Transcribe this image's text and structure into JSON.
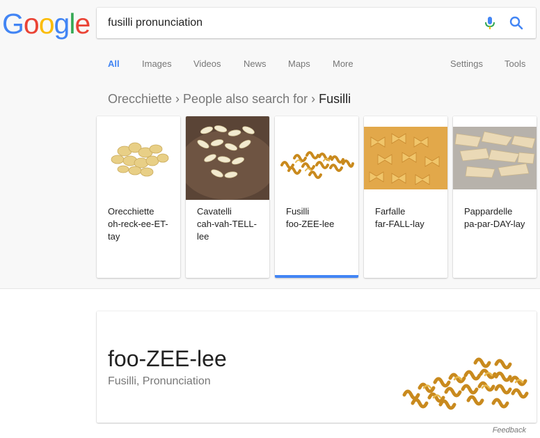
{
  "logo": {
    "letters": [
      "G",
      "o",
      "o",
      "g",
      "l",
      "e"
    ],
    "colors": [
      "#4285f4",
      "#ea4335",
      "#fbbc05",
      "#4285f4",
      "#34a853",
      "#ea4335"
    ]
  },
  "search": {
    "query": "fusilli pronunciation"
  },
  "tabs": {
    "all": "All",
    "images": "Images",
    "videos": "Videos",
    "news": "News",
    "maps": "Maps",
    "more": "More",
    "settings": "Settings",
    "tools": "Tools"
  },
  "breadcrumb": {
    "first": "Orecchiette",
    "second": "People also search for",
    "current": "Fusilli"
  },
  "carousel": [
    {
      "name": "Orecchiette",
      "pron": "oh-reck-ee-ET-tay",
      "icon": "orecchiette-image"
    },
    {
      "name": "Cavatelli",
      "pron": "cah-vah-TELL-lee",
      "icon": "cavatelli-image"
    },
    {
      "name": "Fusilli",
      "pron": "foo-ZEE-lee",
      "icon": "fusilli-image",
      "selected": true
    },
    {
      "name": "Farfalle",
      "pron": "far-FALL-lay",
      "icon": "farfalle-image"
    },
    {
      "name": "Pappardelle",
      "pron": "pa-par-DAY-lay",
      "icon": "pappardelle-image"
    }
  ],
  "answer": {
    "pronunciation": "foo-ZEE-lee",
    "subtitle": "Fusilli, Pronunciation"
  },
  "feedback": "Feedback",
  "colors": {
    "accent": "#4285f4",
    "background": "#f8f8f8"
  }
}
